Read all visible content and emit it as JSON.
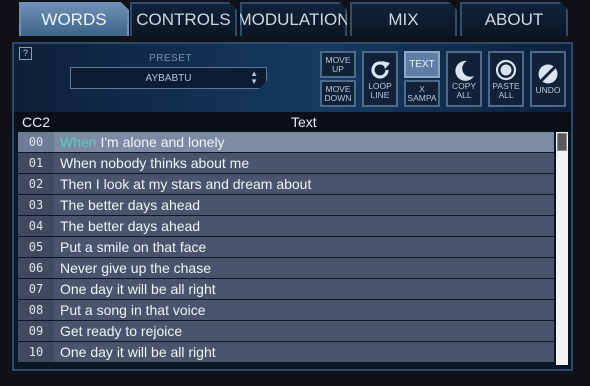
{
  "tabs": [
    {
      "label": "WORDS",
      "active": true
    },
    {
      "label": "CONTROLS",
      "active": false
    },
    {
      "label": "MODULATION",
      "active": false
    },
    {
      "label": "MIX",
      "active": false
    },
    {
      "label": "ABOUT",
      "active": false
    }
  ],
  "help_label": "?",
  "preset": {
    "label": "PRESET",
    "value": "AYBABTU"
  },
  "toolbar_buttons": {
    "move_up": [
      "MOVE",
      "UP"
    ],
    "move_down": [
      "MOVE",
      "DOWN"
    ],
    "loop_line": [
      "LOOP",
      "LINE"
    ],
    "text": "TEXT",
    "x_sampa": [
      "X",
      "SAMPA"
    ],
    "copy_all": [
      "COPY",
      "ALL"
    ],
    "paste_all": [
      "PASTE",
      "ALL"
    ],
    "undo": "UNDO"
  },
  "columns": {
    "cc": "CC2",
    "text": "Text"
  },
  "rows": [
    {
      "num": "00",
      "highlight": "When",
      "text": " I'm alone and lonely"
    },
    {
      "num": "01",
      "text": "When nobody thinks about me"
    },
    {
      "num": "02",
      "text": "Then I look at my stars and dream about"
    },
    {
      "num": "03",
      "text": "The better days ahead"
    },
    {
      "num": "04",
      "text": "The better days ahead"
    },
    {
      "num": "05",
      "text": "Put a smile on that face"
    },
    {
      "num": "06",
      "text": "Never give up the chase"
    },
    {
      "num": "07",
      "text": "One day it will be all right"
    },
    {
      "num": "08",
      "text": "Put a song in that voice"
    },
    {
      "num": "09",
      "text": "Get ready to rejoice"
    },
    {
      "num": "10",
      "text": "One day it will be all right"
    }
  ],
  "colors": {
    "accent_highlight": "#4fd0c4",
    "active_tab": "#5e7fa3",
    "row_bg": "#4a546c"
  }
}
